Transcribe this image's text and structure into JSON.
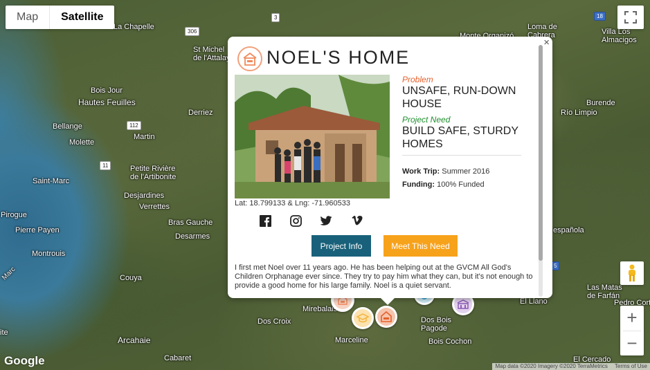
{
  "map_type": {
    "map_label": "Map",
    "satellite_label": "Satellite"
  },
  "places": [
    {
      "name": "La Chapelle"
    },
    {
      "name": "St Michel\nde l'Attalaye"
    },
    {
      "name": "Bois Jour"
    },
    {
      "name": "Hautes Feuilles"
    },
    {
      "name": "Bellange"
    },
    {
      "name": "Molette"
    },
    {
      "name": "Derriez"
    },
    {
      "name": "Martin"
    },
    {
      "name": "Saint-Marc"
    },
    {
      "name": "Petite Rivière\nde l'Artibonite"
    },
    {
      "name": "Desjardines"
    },
    {
      "name": "Verrettes"
    },
    {
      "name": "Pirogue"
    },
    {
      "name": "Pierre Payen"
    },
    {
      "name": "Bras Gauche"
    },
    {
      "name": "Desarmes"
    },
    {
      "name": "Montrouis"
    },
    {
      "name": "Couya"
    },
    {
      "name": "Mirebalais"
    },
    {
      "name": "Dos Croix"
    },
    {
      "name": "Dos Bois\nPagode"
    },
    {
      "name": "Marceline"
    },
    {
      "name": "Bois Cochon"
    },
    {
      "name": "Arcahaie"
    },
    {
      "name": "Cabaret"
    },
    {
      "name": "Loma de\nCabrera"
    },
    {
      "name": "Villa Los\nAlmacigos"
    },
    {
      "name": "Burende"
    },
    {
      "name": "Río Limpio"
    },
    {
      "name": "Monte Organizó"
    },
    {
      "name": "española"
    },
    {
      "name": "Las Matas\nde Farfán"
    },
    {
      "name": "El Llano"
    },
    {
      "name": "Pedro Corto"
    },
    {
      "name": "El Cercado"
    },
    {
      "name": "Marc"
    },
    {
      "name": "ite"
    }
  ],
  "road_shields": [
    "3",
    "306",
    "112",
    "11",
    "18",
    "5"
  ],
  "popup": {
    "title": "NOEL'S HOME",
    "latlng": "Lat: 18.799133 & Lng: -71.960533",
    "problem_label": "Problem",
    "problem_text": "UNSAFE, RUN-DOWN HOUSE",
    "need_label": "Project Need",
    "need_text": "BUILD SAFE, STURDY HOMES",
    "work_trip_label": "Work Trip:",
    "work_trip_value": "Summer 2016",
    "funding_label": "Funding:",
    "funding_value": "100% Funded",
    "project_info_label": "Project Info",
    "meet_need_label": "Meet This Need",
    "description": "I first met Noel over 11 years ago. He has been helping out at the GVCM All God's Children Orphanage ever since. They try to pay him what they can, but it's not enough to provide a good home for his large family. Noel is a quiet servant.",
    "close_label": "×",
    "social": [
      "facebook-icon",
      "instagram-icon",
      "twitter-icon",
      "vimeo-icon"
    ]
  },
  "colors": {
    "problem": "#e5612c",
    "need": "#1f8f2e",
    "info_btn": "#19617a",
    "meet_btn": "#f7a21b",
    "home_marker": "#f08a5d",
    "school_marker": "#f4b43a",
    "church_marker": "#8e5bb5"
  },
  "google_logo": "Google",
  "attribution": {
    "data": "Map data ©2020 Imagery ©2020 TerraMetrics",
    "terms": "Terms of Use"
  },
  "zoom": {
    "in": "+",
    "out": "−"
  }
}
